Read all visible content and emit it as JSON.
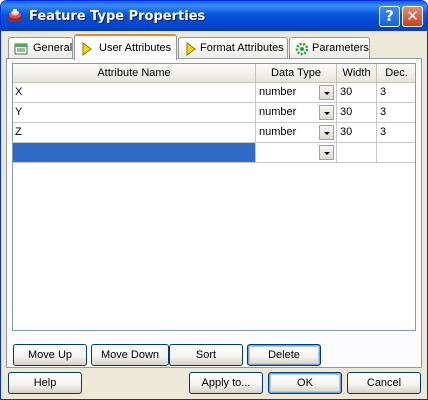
{
  "window": {
    "title": "Feature Type Properties",
    "help_glyph": "?",
    "close_glyph": "✕"
  },
  "tabs": [
    {
      "label": "General",
      "icon": "general-icon",
      "active": false
    },
    {
      "label": "User Attributes",
      "icon": "diamond-arrow-icon",
      "active": true
    },
    {
      "label": "Format Attributes",
      "icon": "diamond-arrow-icon",
      "active": false
    },
    {
      "label": "Parameters",
      "icon": "gear-icon",
      "active": false
    }
  ],
  "table": {
    "headers": [
      "Attribute Name",
      "Data Type",
      "Width",
      "Dec."
    ],
    "rows": [
      {
        "name": "X",
        "type": "number",
        "width": "30",
        "dec": "3"
      },
      {
        "name": "Y",
        "type": "number",
        "width": "30",
        "dec": "3"
      },
      {
        "name": "Z",
        "type": "number",
        "width": "30",
        "dec": "3"
      },
      {
        "name": "",
        "type": "",
        "width": "",
        "dec": ""
      }
    ]
  },
  "panel_buttons": {
    "move_up": "Move Up",
    "move_down": "Move Down",
    "sort": "Sort",
    "delete": "Delete"
  },
  "dialog_buttons": {
    "help": "Help",
    "apply_to": "Apply to...",
    "ok": "OK",
    "cancel": "Cancel"
  },
  "colors": {
    "title_bar": "#0a5fe6",
    "selection": "#316ac5",
    "active_tab_accent": "#e68b2c",
    "dialog_bg": "#ece9d8"
  }
}
